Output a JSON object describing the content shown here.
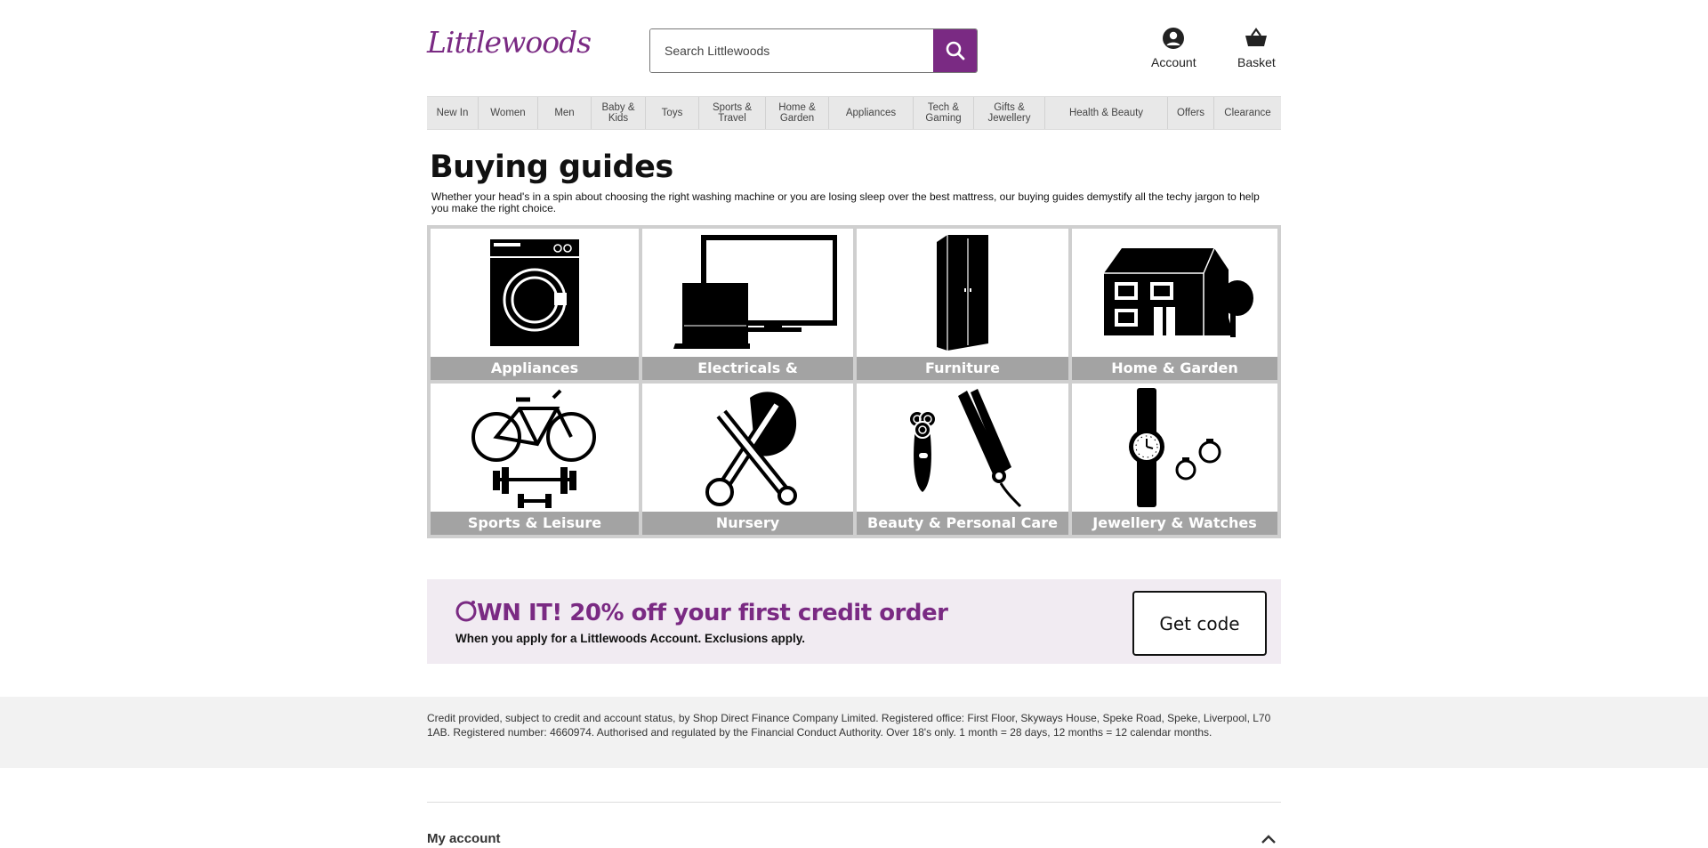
{
  "header": {
    "logo": "Littlewoods",
    "search_placeholder": "Search Littlewoods",
    "account_label": "Account",
    "basket_label": "Basket",
    "brand_color": "#7a2a83"
  },
  "nav": {
    "items": [
      {
        "label": "New In"
      },
      {
        "label": "Women"
      },
      {
        "label": "Men"
      },
      {
        "label": "Baby & Kids"
      },
      {
        "label": "Toys"
      },
      {
        "label": "Sports & Travel"
      },
      {
        "label": "Home & Garden"
      },
      {
        "label": "Appliances"
      },
      {
        "label": "Tech & Gaming"
      },
      {
        "label": "Gifts & Jewellery"
      },
      {
        "label": "Health & Beauty"
      },
      {
        "label": "Offers"
      },
      {
        "label": "Clearance"
      }
    ]
  },
  "page": {
    "title": "Buying guides",
    "intro": "Whether your head's in a spin about choosing the right washing machine or you are losing sleep over the best mattress, our buying guides demystify all the techy jargon to help you make the right choice."
  },
  "guides": [
    {
      "label": "Appliances",
      "icon": "washing-machine-icon"
    },
    {
      "label": "Electricals & Entertainment",
      "icon": "tv-laptop-icon"
    },
    {
      "label": "Furniture",
      "icon": "wardrobe-icon"
    },
    {
      "label": "Home & Garden",
      "icon": "house-icon"
    },
    {
      "label": "Sports & Leisure",
      "icon": "bicycle-dumbbell-icon"
    },
    {
      "label": "Nursery",
      "icon": "pram-icon"
    },
    {
      "label": "Beauty & Personal Care",
      "icon": "shaver-straightener-icon"
    },
    {
      "label": "Jewellery & Watches",
      "icon": "watch-rings-icon"
    }
  ],
  "promo": {
    "headline": "WN IT! 20% off your first credit order",
    "subtext": "When you apply for a Littlewoods Account. Exclusions apply.",
    "button": "Get code"
  },
  "legal": "Credit provided, subject to credit and account status, by Shop Direct Finance Company Limited. Registered office: First Floor, Skyways House, Speke Road, Speke, Liverpool, L70 1AB. Registered number: 4660974. Authorised and regulated by the Financial Conduct Authority. Over 18's only. 1 month = 28 days, 12 months = 12 calendar months.",
  "footer": {
    "my_account": "My account"
  }
}
